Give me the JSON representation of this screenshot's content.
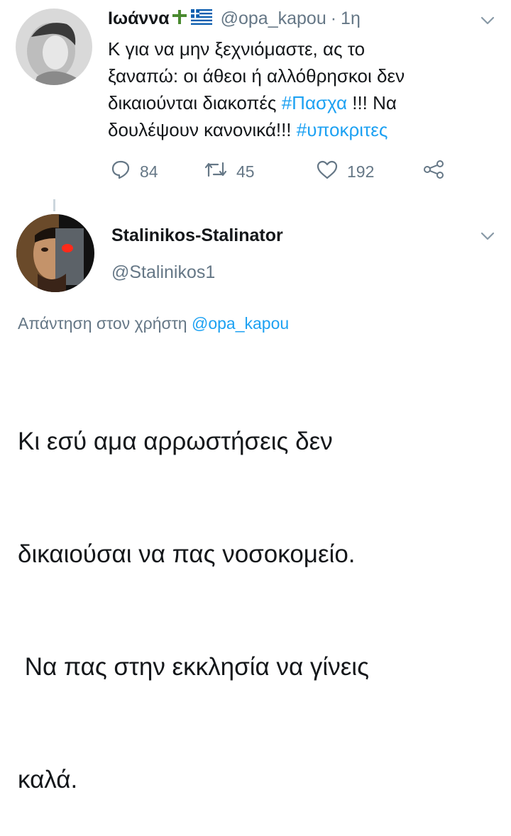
{
  "tweet1": {
    "name": "Ιωάννα",
    "handle": "@opa_kapou",
    "separator": "·",
    "time": "1η",
    "text_line1": "Κ για να μην ξεχνιόμαστε, ας το",
    "text_line2": "ξαναπώ: οι άθεοι ή αλλόθρησκοι δεν",
    "text_line3a": "δικαιούνται διακοπές ",
    "hashtag1": "#Πασχα",
    "text_line3b": " !!! Να",
    "text_line4a": "δουλέψουν κανονικά!!! ",
    "hashtag2": "#υποκριτες",
    "replies": "84",
    "retweets": "45",
    "likes": "192"
  },
  "tweet2": {
    "name": "Stalinikos-Stalinator",
    "handle": "@Stalinikos1",
    "reply_prefix": "Απάντηση στον χρήστη ",
    "reply_mention": "@opa_kapou",
    "text_line1": "Κι εσύ αμα αρρωστήσεις δεν",
    "text_line2": "δικαιούσαι να πας νοσοκομείο.",
    "text_line3": " Να πας στην εκκλησία να γίνεις",
    "text_line4": "καλά."
  },
  "colors": {
    "link": "#1da1f2",
    "muted": "#657786",
    "text": "#14171a"
  },
  "icons": [
    "cross-emoji-icon",
    "greek-flag-icon",
    "chevron-down-icon",
    "reply-icon",
    "retweet-icon",
    "like-icon",
    "share-icon"
  ]
}
